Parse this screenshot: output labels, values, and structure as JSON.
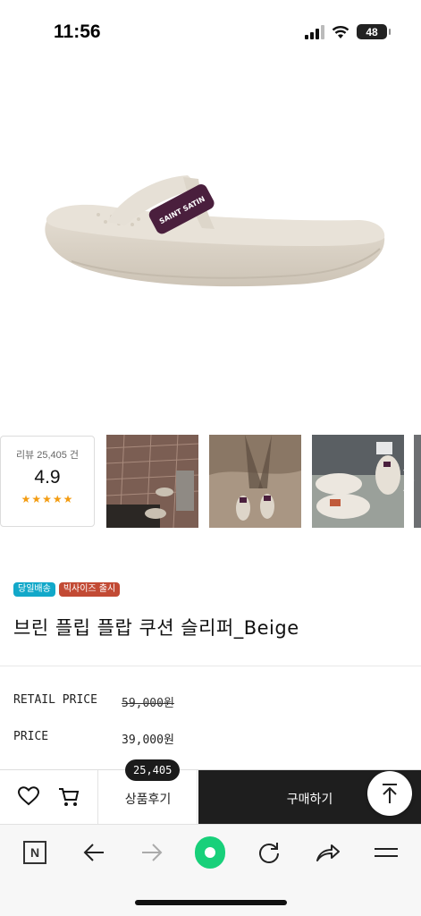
{
  "status_bar": {
    "time": "11:56",
    "battery": "48",
    "icons": [
      "cellular-signal-icon",
      "wifi-icon",
      "battery-icon"
    ]
  },
  "product": {
    "image_subject": "sandal",
    "colors": {
      "sandal": "#dcd4c8",
      "strap": "#4a1f3d"
    }
  },
  "gallery": {
    "review_label": "리뷰 25,405 건",
    "rating": "4.9",
    "stars": "★★★★★",
    "photos": [
      "review-photo-1",
      "review-photo-2",
      "review-photo-3"
    ]
  },
  "badges": {
    "same_day": "당일배송",
    "big_size": "빅사이즈 출시"
  },
  "title": "브린 플립 플랍 쿠션 슬리퍼_Beige",
  "prices": {
    "retail_label": "RETAIL PRICE",
    "retail_value": "59,000원",
    "price_label": "PRICE",
    "price_value": "39,000원"
  },
  "purchase_bar": {
    "review_count": "25,405",
    "review_tab": "상품후기",
    "buy": "구매하기",
    "icons": [
      "heart-icon",
      "cart-icon",
      "arrow-up-icon"
    ]
  },
  "browser_toolbar": {
    "icons": [
      "naver-icon",
      "back-arrow-icon",
      "forward-arrow-icon",
      "green-home-icon",
      "reload-icon",
      "share-icon",
      "menu-icon"
    ],
    "accent": "#18d07a"
  }
}
